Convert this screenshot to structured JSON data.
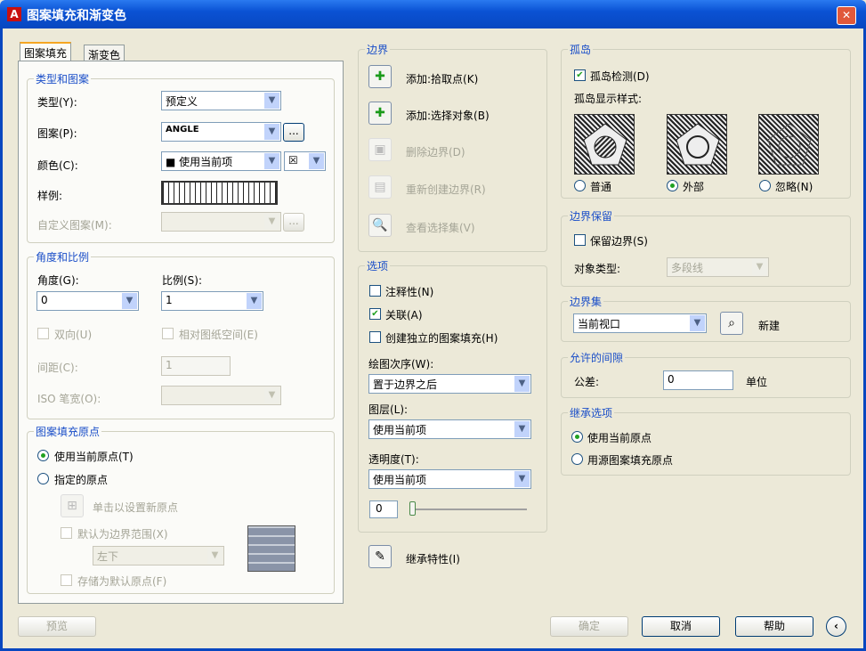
{
  "window": {
    "title": "图案填充和渐变色",
    "close": "✕",
    "app_icon": "A"
  },
  "tabs": [
    "图案填充",
    "渐变色"
  ],
  "type_pattern": {
    "legend": "类型和图案",
    "type_label": "类型(Y):",
    "type_value": "预定义",
    "pattern_label": "图案(P):",
    "pattern_value": "ANGLE",
    "color_label": "颜色(C):",
    "color_value": "■ 使用当前项",
    "bg_color_value": "☒",
    "swatch_label": "样例:",
    "custom_label": "自定义图案(M):",
    "ellipsis": "..."
  },
  "angle_scale": {
    "legend": "角度和比例",
    "angle_label": "角度(G):",
    "angle_value": "0",
    "scale_label": "比例(S):",
    "scale_value": "1",
    "double_label": "双向(U)",
    "relative_label": "相对图纸空间(E)",
    "spacing_label": "间距(C):",
    "spacing_value": "1",
    "iso_label": "ISO 笔宽(O):"
  },
  "origin": {
    "legend": "图案填充原点",
    "use_current": "使用当前原点(T)",
    "specified": "指定的原点",
    "click_set": "单击以设置新原点",
    "default_extents": "默认为边界范围(X)",
    "position_value": "左下",
    "store_default": "存储为默认原点(F)"
  },
  "boundaries": {
    "legend": "边界",
    "add_pick": "添加:拾取点(K)",
    "add_select": "添加:选择对象(B)",
    "remove": "删除边界(D)",
    "recreate": "重新创建边界(R)",
    "view": "查看选择集(V)"
  },
  "options": {
    "legend": "选项",
    "annotative": "注释性(N)",
    "associative": "关联(A)",
    "separate": "创建独立的图案填充(H)",
    "draw_order_label": "绘图次序(W):",
    "draw_order_value": "置于边界之后",
    "layer_label": "图层(L):",
    "layer_value": "使用当前项",
    "transparency_label": "透明度(T):",
    "transparency_value": "使用当前项",
    "transparency_amount": "0",
    "transparency_fraction": 0
  },
  "inherit": {
    "label": "继承特性(I)"
  },
  "islands": {
    "legend": "孤岛",
    "detect": "孤岛检测(D)",
    "style_label": "孤岛显示样式:",
    "normal": "普通",
    "outer": "外部",
    "ignore": "忽略(N)"
  },
  "retain": {
    "legend": "边界保留",
    "retain_label": "保留边界(S)",
    "object_type_label": "对象类型:",
    "object_type_value": "多段线"
  },
  "boundary_set": {
    "legend": "边界集",
    "value": "当前视口",
    "new_label": "新建"
  },
  "gap": {
    "legend": "允许的间隙",
    "tolerance_label": "公差:",
    "tolerance_value": "0",
    "unit": "单位"
  },
  "inherit_options": {
    "legend": "继承选项",
    "use_current": "使用当前原点",
    "use_source": "用源图案填充原点"
  },
  "footer": {
    "preview": "预览",
    "ok": "确定",
    "cancel": "取消",
    "help": "帮助",
    "collapse": "‹"
  }
}
